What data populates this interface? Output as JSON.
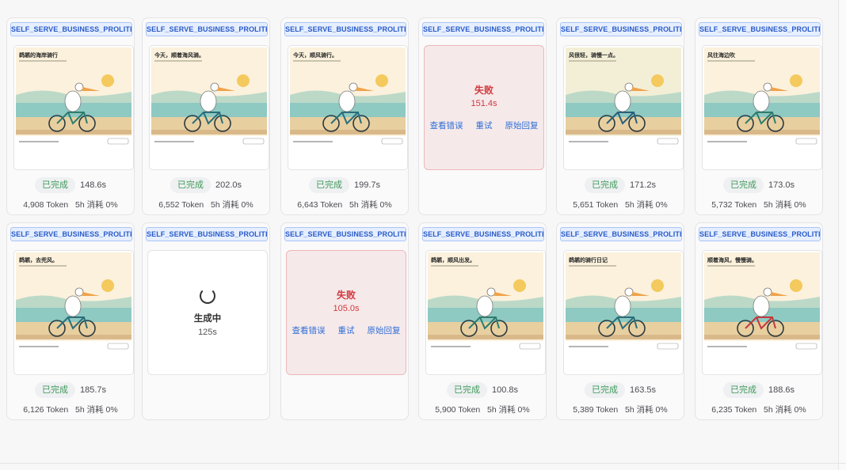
{
  "cards": [
    {
      "tag": "SELF_SERVE_BUSINESS_PROLITE",
      "state": "done",
      "status": "已完成",
      "duration": "148.6s",
      "tokens": "4,908 Token",
      "quota": "5h 消耗 0%"
    },
    {
      "tag": "SELF_SERVE_BUSINESS_PROLITE",
      "state": "done",
      "status": "已完成",
      "duration": "202.0s",
      "tokens": "6,552 Token",
      "quota": "5h 消耗 0%"
    },
    {
      "tag": "SELF_SERVE_BUSINESS_PROLITE",
      "state": "done",
      "status": "已完成",
      "duration": "199.7s",
      "tokens": "6,643 Token",
      "quota": "5h 消耗 0%"
    },
    {
      "tag": "SELF_SERVE_BUSINESS_PROLITE",
      "state": "failed",
      "fail_label": "失败",
      "fail_time": "151.4s",
      "links": [
        "查看错误",
        "重试",
        "原始回复"
      ]
    },
    {
      "tag": "SELF_SERVE_BUSINESS_PROLITE",
      "state": "done",
      "status": "已完成",
      "duration": "171.2s",
      "tokens": "5,651 Token",
      "quota": "5h 消耗 0%"
    },
    {
      "tag": "SELF_SERVE_BUSINESS_PROLITE",
      "state": "done",
      "status": "已完成",
      "duration": "173.0s",
      "tokens": "5,732 Token",
      "quota": "5h 消耗 0%"
    },
    {
      "tag": "SELF_SERVE_BUSINESS_PROLITE",
      "state": "done",
      "status": "已完成",
      "duration": "185.7s",
      "tokens": "6,126 Token",
      "quota": "5h 消耗 0%"
    },
    {
      "tag": "SELF_SERVE_BUSINESS_PROLITE",
      "state": "generating",
      "gen_label": "生成中",
      "gen_time": "125s"
    },
    {
      "tag": "SELF_SERVE_BUSINESS_PROLITE",
      "state": "failed",
      "fail_label": "失败",
      "fail_time": "105.0s",
      "links": [
        "查看错误",
        "重试",
        "原始回复"
      ]
    },
    {
      "tag": "SELF_SERVE_BUSINESS_PROLITE",
      "state": "done",
      "status": "已完成",
      "duration": "100.8s",
      "tokens": "5,900 Token",
      "quota": "5h 消耗 0%"
    },
    {
      "tag": "SELF_SERVE_BUSINESS_PROLITE",
      "state": "done",
      "status": "已完成",
      "duration": "163.5s",
      "tokens": "5,389 Token",
      "quota": "5h 消耗 0%"
    },
    {
      "tag": "SELF_SERVE_BUSINESS_PROLITE",
      "state": "done",
      "status": "已完成",
      "duration": "188.6s",
      "tokens": "6,235 Token",
      "quota": "5h 消耗 0%"
    }
  ],
  "thumbnails": [
    {
      "title": "鹈鹕的海岸骑行",
      "bike_color": "#2e7d6e",
      "sky": "#fbf1dc"
    },
    {
      "title": "今天，顺着海风骑。",
      "bike_color": "#2a6e7a",
      "sky": "#fbf1dc"
    },
    {
      "title": "今天，顺风骑行。",
      "bike_color": "#2a6e7a",
      "sky": "#fbf1dc"
    },
    {
      "title": "风很轻，骑慢一点。",
      "bike_color": "#2a5f7a",
      "sky": "#f3efd7"
    },
    {
      "title": "风往海边吹",
      "bike_color": "#2e7d6e",
      "sky": "#fbf1dc"
    },
    {
      "title": "鹈鹕，去兜风。",
      "bike_color": "#2a6e7a",
      "sky": "#fbf1dc"
    },
    {
      "title": "鹈鹕，顺风出发。",
      "bike_color": "#2e7d6e",
      "sky": "#fbf1dc"
    },
    {
      "title": "鹈鹕的骑行日记",
      "bike_color": "#2a6e7a",
      "sky": "#fbf1dc"
    },
    {
      "title": "顺着海风，慢慢骑。",
      "bike_color": "#c0393e",
      "sky": "#fbf1dc"
    }
  ]
}
